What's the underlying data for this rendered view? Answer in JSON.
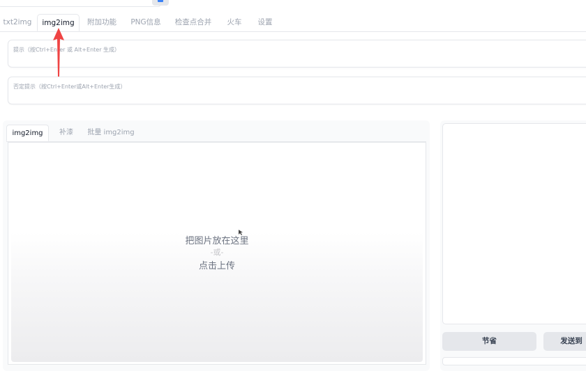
{
  "main_tabs": [
    {
      "label": "txt2img",
      "active": false
    },
    {
      "label": "img2img",
      "active": true
    },
    {
      "label": "附加功能",
      "active": false
    },
    {
      "label": "PNG信息",
      "active": false
    },
    {
      "label": "检查点合并",
      "active": false
    },
    {
      "label": "火车",
      "active": false
    },
    {
      "label": "设置",
      "active": false
    }
  ],
  "prompt": {
    "placeholder": "提示（按Ctrl+Enter 或 Alt+Enter 生成）"
  },
  "negative_prompt": {
    "placeholder": "否定提示（按Ctrl+Enter或Alt+Enter生成）"
  },
  "sub_tabs": [
    {
      "label": "img2img",
      "active": true
    },
    {
      "label": "补漆",
      "active": false
    },
    {
      "label": "批量 img2img",
      "active": false
    }
  ],
  "upload": {
    "drop_text": "把图片放在这里",
    "or_text": "-或-",
    "click_text": "点击上传"
  },
  "right_buttons": {
    "save": "节省",
    "send": "发送到"
  },
  "colors": {
    "arrow": "#ef4444",
    "accent": "#3b82f6",
    "button_bg": "#e5e7eb"
  }
}
